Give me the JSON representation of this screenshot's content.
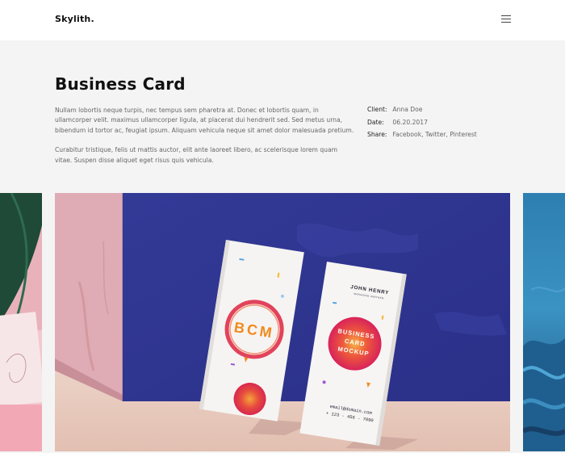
{
  "brand": {
    "logo": "Skylith."
  },
  "nav": {
    "menu_icon": "hamburger-menu-icon"
  },
  "project": {
    "title": "Business Card",
    "description": [
      "Nullam lobortis neque turpis, nec tempus sem pharetra at. Donec et lobortis quam, in ullamcorper velit. maximus ullamcorper ligula, at placerat dui hendrerit sed. Sed metus urna, bibendum id tortor ac, feugiat ipsum. Aliquam vehicula neque sit amet dolor malesuada pretium.",
      "Curabitur tristique, felis ut mattis auctor, elit ante laoreet libero, ac scelerisque lorem quam vitae. Suspen disse aliquet eget risus quis vehicula."
    ],
    "meta": [
      {
        "label": "Client:",
        "value": "Anna Doe"
      },
      {
        "label": "Date:",
        "value": "06.20.2017"
      },
      {
        "label": "Share:",
        "value": "Facebook, Twitter, Pinterest"
      }
    ]
  },
  "mockup": {
    "card_left_text": "BCM",
    "card_right_name": "JOHN HENRY",
    "card_right_role": "MANAGING PARTNER",
    "card_right_title_1": "BUSINESS",
    "card_right_title_2": "CARD",
    "card_right_title_3": "MOCKUP",
    "card_right_email": "email@domain.com",
    "card_right_phone": "+ 123 - 456 - 7890"
  },
  "colors": {
    "hero_bg": "#f4f4f4",
    "wall_blue": "#2e3590",
    "wall_pink": "#d8a0ac",
    "floor": "#e7c8bc",
    "accent_red": "#e0304a",
    "accent_orange": "#f08a1e"
  }
}
